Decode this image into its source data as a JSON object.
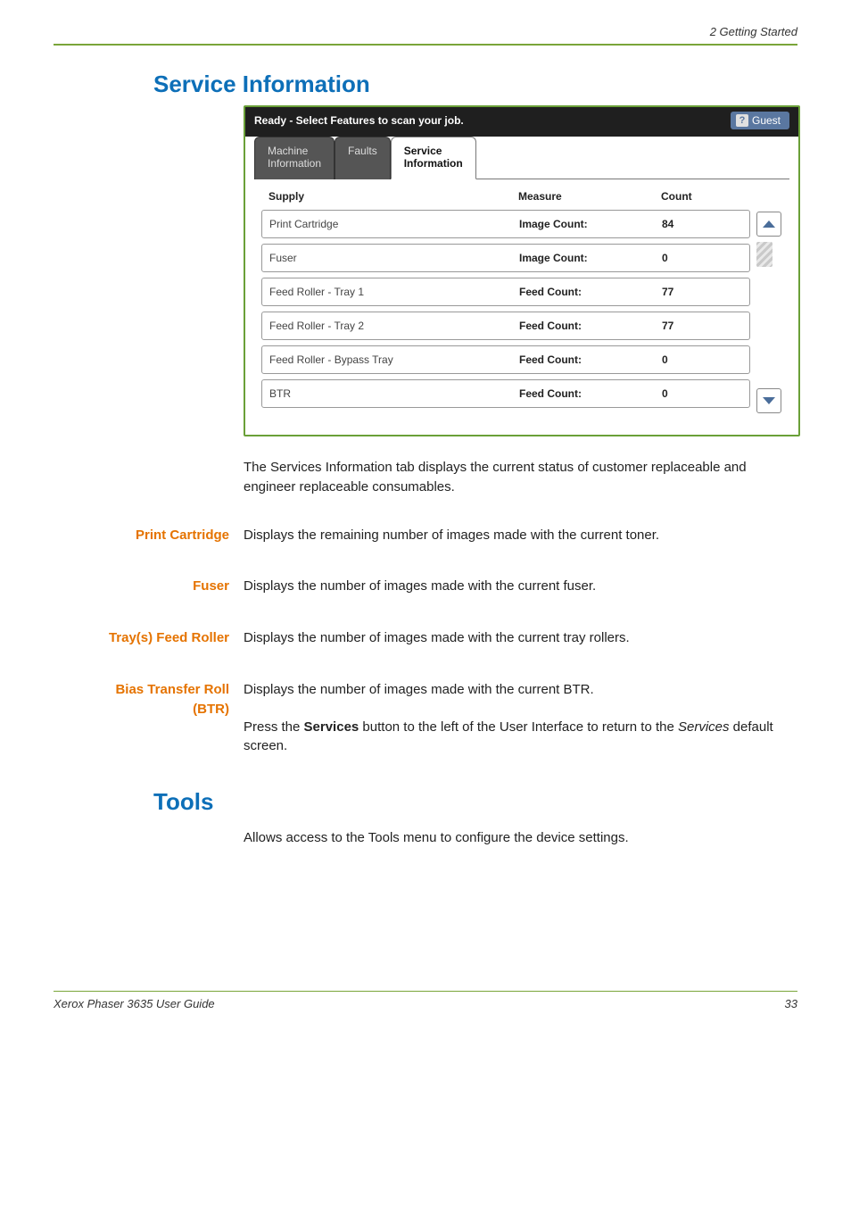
{
  "page_header_right": "2 Getting Started",
  "section_title": "Service Information",
  "sim": {
    "ready_text": "Ready -  Select Features to scan your job.",
    "guest_label": "Guest",
    "tabs": {
      "machine_line1": "Machine",
      "machine_line2": "Information",
      "faults": "Faults",
      "service_line1": "Service",
      "service_line2": "Information"
    },
    "headers": {
      "supply": "Supply",
      "measure": "Measure",
      "count": "Count"
    },
    "rows": [
      {
        "supply": "Print Cartridge",
        "measure": "Image Count:",
        "count": "84"
      },
      {
        "supply": "Fuser",
        "measure": "Image Count:",
        "count": "0"
      },
      {
        "supply": "Feed Roller - Tray 1",
        "measure": "Feed Count:",
        "count": "77"
      },
      {
        "supply": "Feed Roller - Tray 2",
        "measure": "Feed Count:",
        "count": "77"
      },
      {
        "supply": "Feed Roller - Bypass Tray",
        "measure": "Feed Count:",
        "count": "0"
      },
      {
        "supply": "BTR",
        "measure": "Feed Count:",
        "count": "0"
      }
    ]
  },
  "intro_para": "The Services Information tab displays the current status of customer replaceable and engineer replaceable consumables.",
  "defs": {
    "print_cartridge": {
      "label": "Print Cartridge",
      "body": "Displays the remaining number of images made with the current toner."
    },
    "fuser": {
      "label": "Fuser",
      "body": "Displays the number of images made with the current fuser."
    },
    "tray_roller": {
      "label": "Tray(s) Feed Roller",
      "body": "Displays the number of images made with the current tray rollers."
    },
    "btr": {
      "label_line1": "Bias Transfer Roll",
      "label_line2": "(BTR)",
      "body1": "Displays the number of images made with the current BTR.",
      "body2_pre": "Press the ",
      "body2_bold": "Services",
      "body2_mid": " button to the left of the User Interface to return to the ",
      "body2_ital": "Services",
      "body2_post": " default screen."
    }
  },
  "tools": {
    "title": "Tools",
    "body": "Allows access to the Tools menu to configure the device settings."
  },
  "footer": {
    "left": "Xerox Phaser 3635 User Guide",
    "right": "33"
  }
}
